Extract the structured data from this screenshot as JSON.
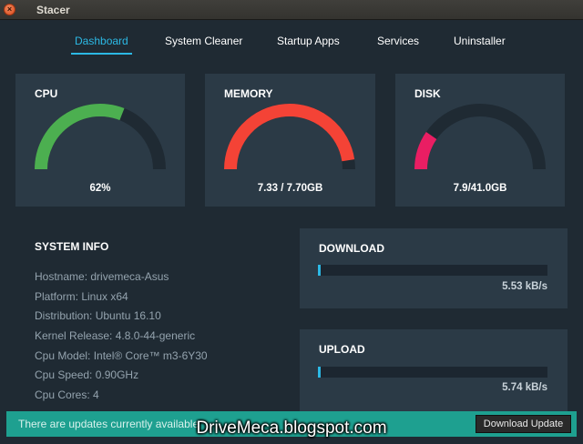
{
  "window": {
    "title": "Stacer",
    "close_glyph": "×"
  },
  "tabs": [
    {
      "label": "Dashboard",
      "active": true
    },
    {
      "label": "System Cleaner",
      "active": false
    },
    {
      "label": "Startup Apps",
      "active": false
    },
    {
      "label": "Services",
      "active": false
    },
    {
      "label": "Uninstaller",
      "active": false
    }
  ],
  "gauges": {
    "cpu": {
      "title": "CPU",
      "value_text": "62%",
      "fraction": 0.62,
      "color": "#4caf50"
    },
    "memory": {
      "title": "MEMORY",
      "value_text": "7.33 / 7.70GB",
      "fraction": 0.952,
      "color": "#f44336"
    },
    "disk": {
      "title": "DISK",
      "value_text": "7.9/41.0GB",
      "fraction": 0.193,
      "color": "#e91e63"
    }
  },
  "gauge_track_color": "#1f2a33",
  "system_info": {
    "title": "SYSTEM INFO",
    "rows": [
      "Hostname: drivemeca-Asus",
      "Platform: Linux x64",
      "Distribution: Ubuntu 16.10",
      "Kernel Release: 4.8.0-44-generic",
      "Cpu Model: Intel® Core™ m3-6Y30",
      "Cpu Speed: 0.90GHz",
      "Cpu Cores: 4"
    ]
  },
  "network": {
    "download": {
      "title": "DOWNLOAD",
      "value": "5.53 kB/s",
      "fraction": 0.006
    },
    "upload": {
      "title": "UPLOAD",
      "value": "5.74 kB/s",
      "fraction": 0.006
    }
  },
  "update_bar": {
    "message": "There are updates currently available",
    "button_label": "Download Update"
  },
  "watermark": "DriveMeca.blogspot.com"
}
